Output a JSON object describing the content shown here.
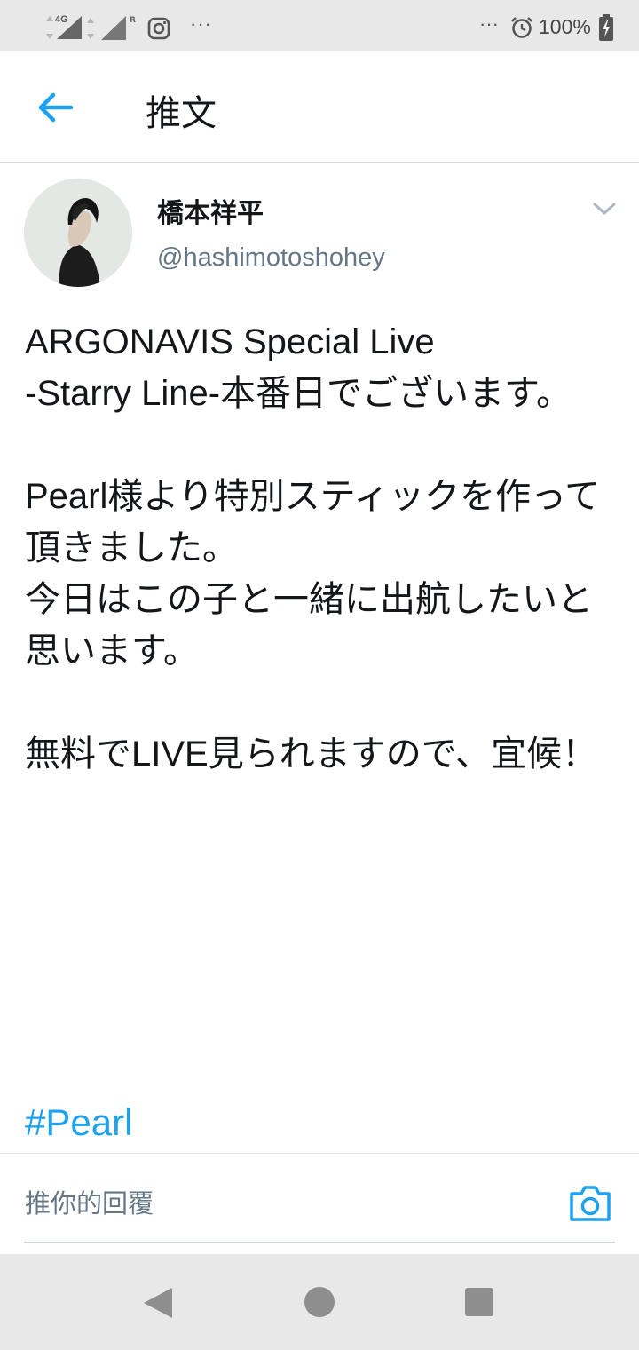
{
  "status_bar": {
    "network_label": "4G",
    "roaming_label": "R",
    "left_overflow": "···",
    "right_overflow": "···",
    "battery_percent": "100%"
  },
  "header": {
    "title": "推文"
  },
  "tweet": {
    "author_name": "橋本祥平",
    "author_handle": "@hashimotoshohey",
    "text": "ARGONAVIS Special Live\n-Starry Line-本番日でございます。\n\nPearl様より特別スティックを作って頂きました。\n今日はこの子と一緒に出航したいと思います。\n\n無料でLIVE見られますので、宜候！",
    "hashtag": "#Pearl"
  },
  "reply": {
    "placeholder": "推你的回覆"
  },
  "colors": {
    "accent": "#1da1f2",
    "text_primary": "#14171a",
    "text_secondary": "#657786",
    "system_bar": "#e8e8e8"
  }
}
